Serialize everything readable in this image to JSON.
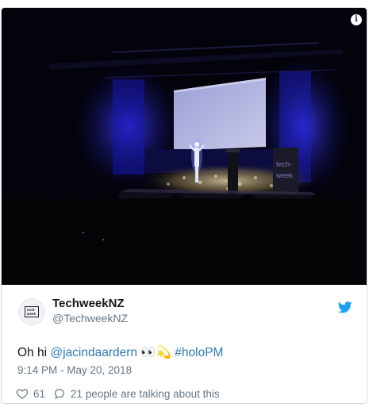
{
  "media": {
    "info_label": "i",
    "sign_text": [
      "tech-",
      "week"
    ]
  },
  "account": {
    "name": "TechweekNZ",
    "handle": "@TechweekNZ",
    "avatar_text": [
      "tech-",
      "week"
    ]
  },
  "tweet": {
    "prefix": "Oh hi ",
    "mention": "@jacindaardern",
    "emoji": "👀💫",
    "hashtag": "#holoPM",
    "timestamp": "9:14 PM - May 20, 2018"
  },
  "actions": {
    "like_count": "61",
    "talking_text": "21 people are talking about this"
  },
  "colors": {
    "link": "#2b7bb9",
    "twitter_blue": "#1da1f2",
    "muted": "#657786"
  }
}
